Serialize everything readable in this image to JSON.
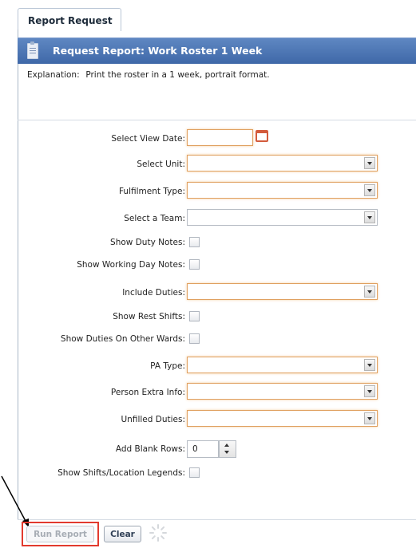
{
  "tab": {
    "label": "Report Request"
  },
  "header": {
    "title": "Request Report: Work Roster 1 Week",
    "icon": "clipboard-icon"
  },
  "explanation": {
    "label": "Explanation:",
    "text": "Print the roster in a 1 week, portrait format."
  },
  "fields": {
    "view_date": {
      "label": "Select View Date:",
      "value": ""
    },
    "unit": {
      "label": "Select Unit:",
      "value": ""
    },
    "fulfilment_type": {
      "label": "Fulfilment Type:",
      "value": ""
    },
    "team": {
      "label": "Select a Team:",
      "value": ""
    },
    "duty_notes": {
      "label": "Show Duty Notes:",
      "checked": false
    },
    "working_day_notes": {
      "label": "Show Working Day Notes:",
      "checked": false
    },
    "include_duties": {
      "label": "Include Duties:",
      "value": ""
    },
    "rest_shifts": {
      "label": "Show Rest Shifts:",
      "checked": false
    },
    "other_wards": {
      "label": "Show Duties On Other Wards:",
      "checked": false
    },
    "pa_type": {
      "label": "PA Type:",
      "value": ""
    },
    "person_extra_info": {
      "label": "Person Extra Info:",
      "value": ""
    },
    "unfilled_duties": {
      "label": "Unfilled Duties:",
      "value": ""
    },
    "blank_rows": {
      "label": "Add Blank Rows:",
      "value": "0"
    },
    "legends": {
      "label": "Show Shifts/Location Legends:",
      "checked": false
    }
  },
  "buttons": {
    "run_report": "Run Report",
    "clear": "Clear"
  },
  "colors": {
    "header": "#3f68a8",
    "required_border": "#e0a060",
    "highlight": "#e23a2e"
  }
}
